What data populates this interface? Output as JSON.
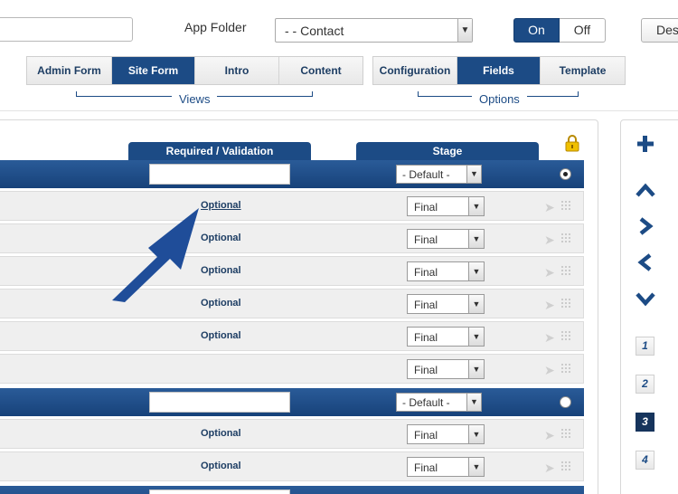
{
  "top": {
    "app_folder_label": "App Folder",
    "app_folder_value": "- - Contact",
    "toggle_on": "On",
    "toggle_off": "Off",
    "desc_button": "Desc"
  },
  "views": {
    "label": "Views",
    "tabs": [
      {
        "label": "Admin Form",
        "active": false
      },
      {
        "label": "Site Form",
        "active": true
      },
      {
        "label": "Intro",
        "active": false
      },
      {
        "label": "Content",
        "active": false
      }
    ]
  },
  "options": {
    "label": "Options",
    "tabs": [
      {
        "label": "Configuration",
        "active": false
      },
      {
        "label": "Fields",
        "active": true
      },
      {
        "label": "Template",
        "active": false
      }
    ]
  },
  "columns": {
    "required": "Required / Validation",
    "stage": "Stage"
  },
  "groups": [
    {
      "default_label": "- Default -",
      "radio_checked": true,
      "rows": [
        {
          "required": "Optional",
          "stage": "Final"
        },
        {
          "required": "Optional",
          "stage": "Final"
        },
        {
          "required": "Optional",
          "stage": "Final"
        },
        {
          "required": "Optional",
          "stage": "Final"
        },
        {
          "required": "Optional",
          "stage": "Final"
        },
        {
          "required": "",
          "stage": "Final"
        }
      ]
    },
    {
      "default_label": "- Default -",
      "radio_checked": false,
      "rows": [
        {
          "required": "Optional",
          "stage": "Final"
        },
        {
          "required": "Optional",
          "stage": "Final"
        }
      ]
    }
  ],
  "pages": [
    "1",
    "2",
    "3",
    "4"
  ],
  "active_page": "3",
  "icons": [
    "plus-icon",
    "chevron-up-icon",
    "chevron-right-icon",
    "chevron-left-icon",
    "chevron-down-icon",
    "lock-icon",
    "annotation-arrow"
  ],
  "colors": {
    "brand": "#1c4b85",
    "arrow": "#1f4d99",
    "lock": "#e8b400"
  }
}
